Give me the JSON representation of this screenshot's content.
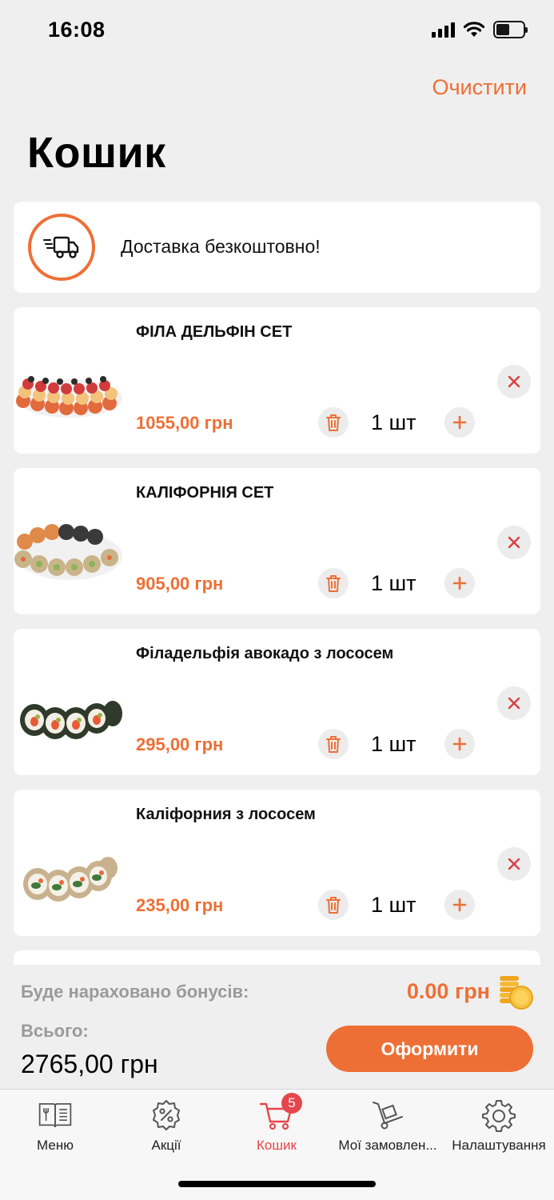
{
  "status_bar": {
    "time": "16:08"
  },
  "header": {
    "clear_label": "Очистити",
    "title": "Кошик"
  },
  "delivery": {
    "text": "Доставка безкоштовно!"
  },
  "items": [
    {
      "name": "ФІЛА ДЕЛЬФІН СЕТ",
      "price": "1055,00 грн",
      "qty": "1 шт"
    },
    {
      "name": "КАЛІФОРНІЯ СЕТ",
      "price": "905,00 грн",
      "qty": "1 шт"
    },
    {
      "name": "Філадельфія авокадо з лососем",
      "price": "295,00 грн",
      "qty": "1 шт"
    },
    {
      "name": "Каліфорния з лососем",
      "price": "235,00 грн",
      "qty": "1 шт"
    }
  ],
  "summary": {
    "bonus_label": "Буде нараховано бонусів:",
    "bonus_value": "0.00 грн",
    "total_label": "Всього:",
    "total_value": "2765,00 грн",
    "checkout_label": "Оформити"
  },
  "tabs": [
    {
      "label": "Меню",
      "icon": "menu-book-icon"
    },
    {
      "label": "Акції",
      "icon": "discount-icon"
    },
    {
      "label": "Кошик",
      "icon": "cart-icon",
      "badge": "5",
      "active": true
    },
    {
      "label": "Мої замовлен...",
      "icon": "hand-truck-icon"
    },
    {
      "label": "Налаштування",
      "icon": "gear-icon"
    }
  ],
  "colors": {
    "accent": "#ee6f35",
    "active_tab": "#e5464b",
    "background": "#efefef"
  }
}
